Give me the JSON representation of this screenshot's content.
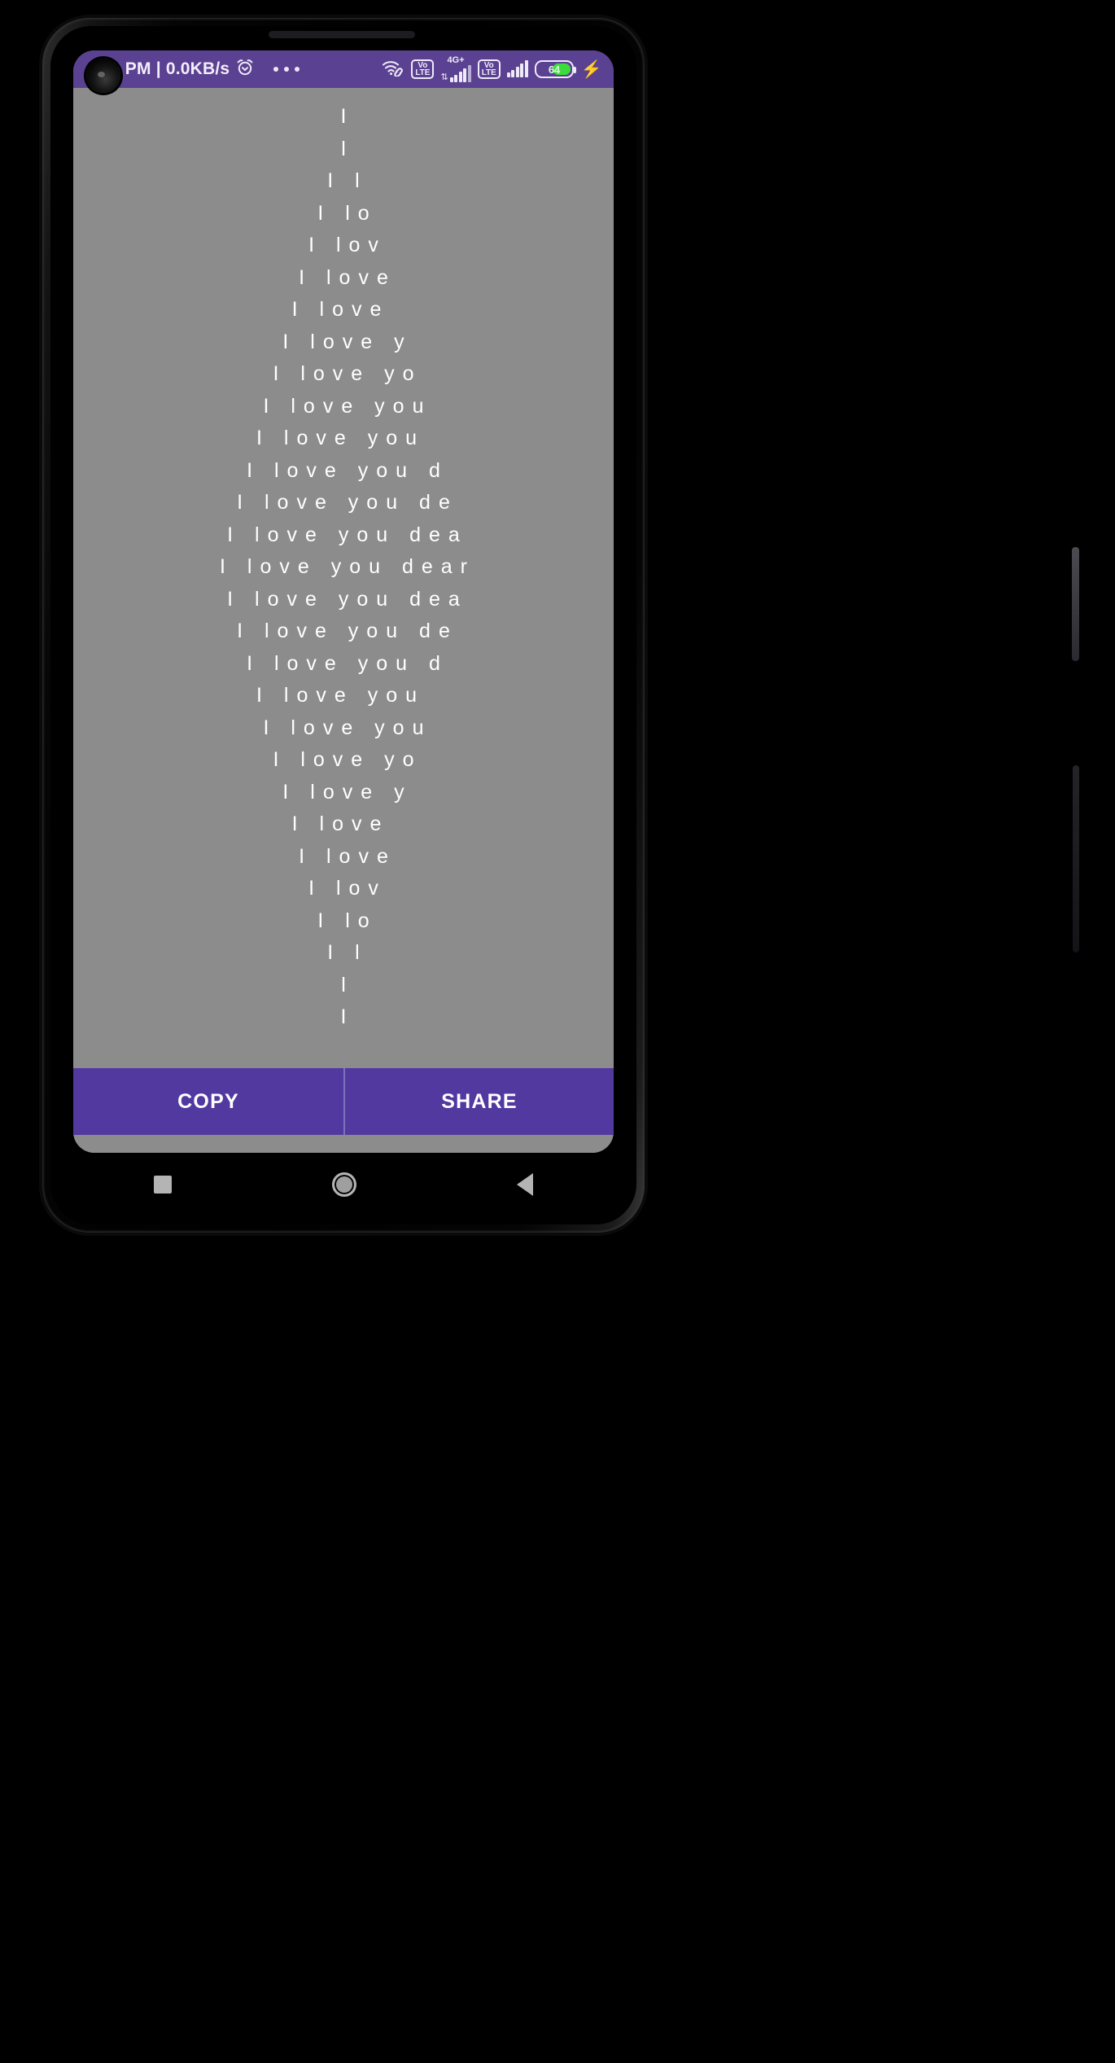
{
  "statusbar": {
    "time_text": "16 PM | 0.0KB/s",
    "alarm_icon": "alarm-clock-icon",
    "overflow_icon": "more-dots-icon",
    "wifi_icon": "wifi-link-icon",
    "volte1_top": "Vo",
    "volte1_bottom": "LTE",
    "network_type": "4G+",
    "data_arrows": "⇅",
    "volte2_top": "Vo",
    "volte2_bottom": "LTE",
    "battery_level": "64",
    "charging_icon": "⚡",
    "accent_purple": "#5b4191",
    "battery_green": "#3ddc3d"
  },
  "art": {
    "base_phrase": "I love you dear",
    "lines": [
      "I",
      "l",
      "I l",
      "I lo",
      "I lov",
      "I love",
      "I love ",
      "I love y",
      "I love yo",
      "I love you",
      "I love you ",
      "I love you d",
      "I love you de",
      "I love you dea",
      "I love you dear",
      "I love you dea",
      "I love you de",
      "I love you d",
      "I love you ",
      "I love you",
      "I love yo",
      "I love y",
      "I love ",
      "I love",
      "I lov",
      "I lo",
      "I l",
      "l",
      "I"
    ],
    "text_color": "#ffffff",
    "background": "#8c8c8c"
  },
  "actions": {
    "copy_label": "COPY",
    "share_label": "SHARE",
    "button_color": "#5139a0"
  },
  "navbar": {
    "recents_icon": "square-recents-icon",
    "home_icon": "circle-home-icon",
    "back_icon": "triangle-back-icon"
  }
}
